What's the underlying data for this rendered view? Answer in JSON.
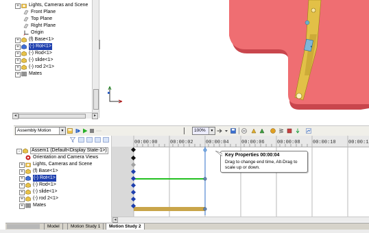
{
  "tree": {
    "items": [
      {
        "label": "Lights, Cameras and Scene",
        "icon": "lights-folder-icon",
        "expander": "+"
      },
      {
        "label": "Front Plane",
        "icon": "plane-icon"
      },
      {
        "label": "Top Plane",
        "icon": "plane-icon"
      },
      {
        "label": "Right Plane",
        "icon": "plane-icon"
      },
      {
        "label": "Origin",
        "icon": "origin-icon"
      },
      {
        "label": "(f) Base<1>",
        "icon": "part-icon",
        "expander": "+"
      },
      {
        "label": "(-) Rot<1>",
        "icon": "part-icon",
        "expander": "+",
        "selected": true
      },
      {
        "label": "(-) Rod<1>",
        "icon": "part-icon",
        "expander": "+"
      },
      {
        "label": "(-) slide<1>",
        "icon": "part-icon",
        "expander": "+"
      },
      {
        "label": "(-) rod 2<1>",
        "icon": "part-icon",
        "expander": "+"
      },
      {
        "label": "Mates",
        "icon": "mates-icon",
        "expander": "+"
      }
    ]
  },
  "motion_toolbar": {
    "study_type": "Assembly Motion",
    "zoom": "100%"
  },
  "motion_tree": {
    "items": [
      {
        "label": "Assem1  (Default<Display State-1>)",
        "icon": "assembly-icon",
        "expander": "-"
      },
      {
        "label": "Orientation and Camera Views",
        "icon": "camera-views-icon"
      },
      {
        "label": "Lights, Cameras and Scene",
        "icon": "lights-folder-icon",
        "expander": "+"
      },
      {
        "label": "(f) Base<1>",
        "icon": "part-icon",
        "expander": "+"
      },
      {
        "label": "(-) Rot<1>",
        "icon": "part-icon",
        "expander": "+",
        "selected": true
      },
      {
        "label": "(-) Rod<1>",
        "icon": "part-icon",
        "expander": "+"
      },
      {
        "label": "(-) slide<1>",
        "icon": "part-icon",
        "expander": "+"
      },
      {
        "label": "(-) rod 2<1>",
        "icon": "part-icon",
        "expander": "+"
      },
      {
        "label": "Mates",
        "icon": "mates-icon",
        "expander": "+"
      }
    ]
  },
  "timeline": {
    "ticks": [
      "00:00:00",
      "00:00:02",
      "00:00:04",
      "00:00:06",
      "00:00:08",
      "00:00:10",
      "00:00:12"
    ],
    "playhead_time": "00:00:04",
    "tooltip_title": "Key Properties 00:00:04",
    "tooltip_body_1": "Drag to change end time, Alt-Drag to",
    "tooltip_body_2": "scale up or down.",
    "colors": {
      "green_bar": "#22c020",
      "tan_bar": "#c9a54a",
      "playhead": "#2c6ec9"
    }
  },
  "tabs": [
    "Model",
    "Motion Study 1",
    "Motion Study 2"
  ],
  "active_tab": "Motion Study 2",
  "colors": {
    "part_face": "#ef6e72",
    "part_dark": "#d9484e",
    "arm": "#e8c84a",
    "selection": "#1e3fae"
  }
}
